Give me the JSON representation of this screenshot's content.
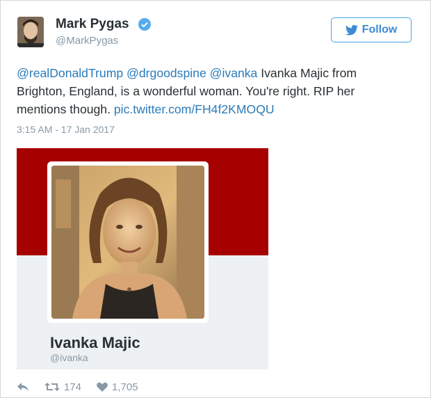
{
  "author": {
    "name": "Mark Pygas",
    "handle": "@MarkPygas"
  },
  "follow_label": "Follow",
  "tweet": {
    "mention1": "@realDonaldTrump",
    "mention2": "@drgoodspine",
    "mention3": "@ivanka",
    "text": "Ivanka Majic from Brighton, England, is a wonderful woman. You're right. RIP her mentions though.",
    "link": "pic.twitter.com/FH4f2KMOQU"
  },
  "timestamp": "3:15 AM - 17 Jan 2017",
  "card": {
    "name": "Ivanka Majic",
    "handle": "@ivanka"
  },
  "stats": {
    "retweets": "174",
    "likes": "1,705"
  },
  "colors": {
    "accent": "#2b7bb9",
    "banner": "#a60000",
    "muted": "#8899a6"
  },
  "icons": [
    "verified-icon",
    "twitter-bird-icon",
    "reply-icon",
    "retweet-icon",
    "heart-icon"
  ]
}
